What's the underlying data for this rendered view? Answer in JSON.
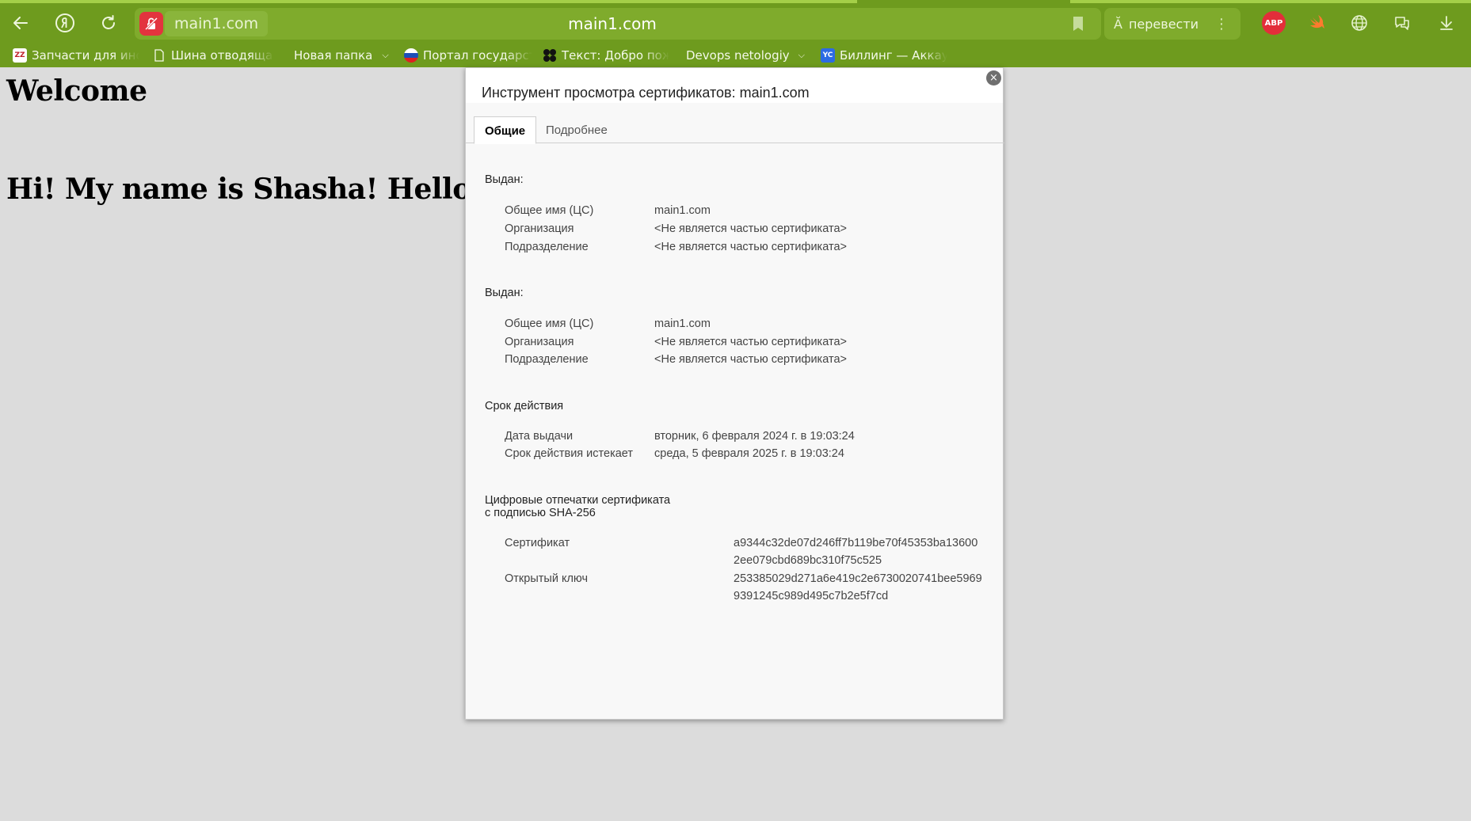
{
  "browser": {
    "domain_pill": "main1.com",
    "url": "main1.com",
    "translate_label": "перевести",
    "abp_label": "ABP",
    "bookmarks": [
      {
        "label": "Запчасти для иномарок",
        "icon_text": "ZZ"
      },
      {
        "label": "Шина отводящая",
        "icon_text": ""
      },
      {
        "label": "Новая папка",
        "icon_text": ""
      },
      {
        "label": "Портал государственных",
        "icon_text": ""
      },
      {
        "label": "Текст: Добро пожаловать",
        "icon_text": ""
      },
      {
        "label": "Devops netologiy",
        "icon_text": ""
      },
      {
        "label": "Биллинг — Аккаунт",
        "icon_text": "YC"
      }
    ],
    "colors": {
      "chrome": "#6e9b1e",
      "accent_red": "#e3343e"
    }
  },
  "page": {
    "heading": "Welcome",
    "subheading": "Hi! My name is Shasha! Hello world"
  },
  "cert": {
    "title": "Инструмент просмотра сертификатов: main1.com",
    "tabs": [
      "Общие",
      "Подробнее"
    ],
    "issued_to": {
      "section": "Выдан:",
      "cn_label": "Общее имя (ЦС)",
      "cn_value": "main1.com",
      "org_label": "Организация",
      "org_value": "<Не является частью сертификата>",
      "ou_label": "Подразделение",
      "ou_value": "<Не является частью сертификата>"
    },
    "issued_by": {
      "section": "Выдан:",
      "cn_label": "Общее имя (ЦС)",
      "cn_value": "main1.com",
      "org_label": "Организация",
      "org_value": "<Не является частью сертификата>",
      "ou_label": "Подразделение",
      "ou_value": "<Не является частью сертификата>"
    },
    "validity": {
      "section": "Срок действия",
      "issued_label": "Дата выдачи",
      "issued_value": "вторник, 6 февраля 2024 г. в 19:03:24",
      "expires_label": "Срок действия истекает",
      "expires_value": "среда, 5 февраля 2025 г. в 19:03:24"
    },
    "fingerprints": {
      "section_line1": "Цифровые отпечатки сертификата",
      "section_line2": "с подписью SHA-256",
      "cert_label": "Сертификат",
      "cert_line1": "a9344c32de07d246ff7b119be70f45353ba13600",
      "cert_line2": "2ee079cbd689bc310f75c525",
      "key_label": "Открытый ключ",
      "key_line1": "253385029d271a6e419c2e6730020741bee5969",
      "key_line2": "9391245c989d495c7b2e5f7cd"
    }
  }
}
